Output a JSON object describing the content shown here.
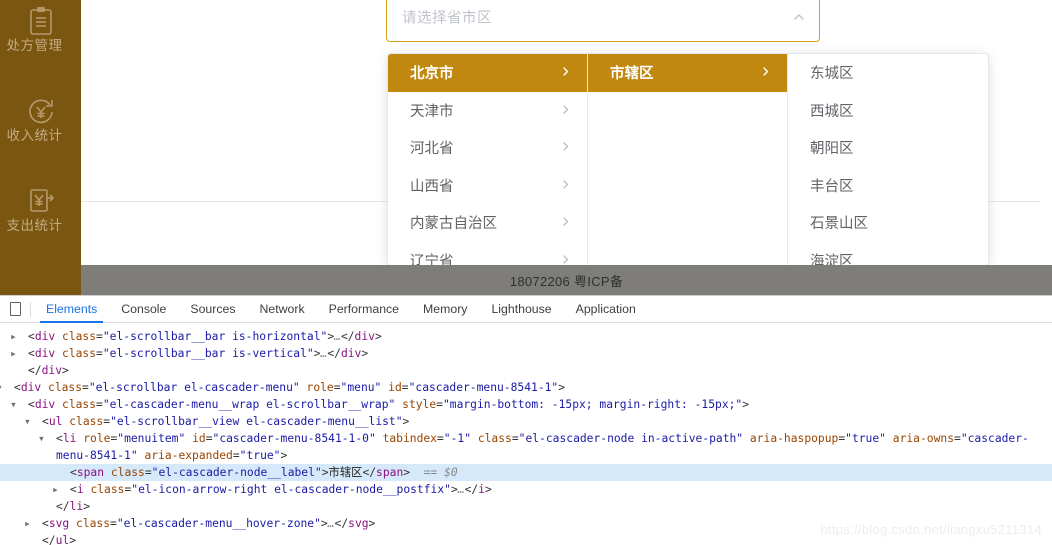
{
  "sidebar": {
    "items": [
      {
        "label": "处方管理",
        "icon": "clipboard-icon"
      },
      {
        "label": "收入统计",
        "icon": "income-yuan-circle-icon"
      },
      {
        "label": "支出统计",
        "icon": "expense-yuan-doc-icon"
      },
      {
        "label": "",
        "icon": "report-doc-icon"
      }
    ]
  },
  "cascader": {
    "placeholder": "请选择省市区",
    "value": "",
    "caret_icon": "chevron-up-icon",
    "columns": [
      {
        "name": "province-column",
        "nodes": [
          {
            "label": "北京市",
            "active": true,
            "has_children": true
          },
          {
            "label": "天津市",
            "active": false,
            "has_children": true
          },
          {
            "label": "河北省",
            "active": false,
            "has_children": true
          },
          {
            "label": "山西省",
            "active": false,
            "has_children": true
          },
          {
            "label": "内蒙古自治区",
            "active": false,
            "has_children": true
          },
          {
            "label": "辽宁省",
            "active": false,
            "has_children": true
          }
        ]
      },
      {
        "name": "city-column",
        "nodes": [
          {
            "label": "市辖区",
            "active": true,
            "has_children": true
          }
        ]
      },
      {
        "name": "district-column",
        "nodes": [
          {
            "label": "东城区",
            "active": false,
            "has_children": false
          },
          {
            "label": "西城区",
            "active": false,
            "has_children": false
          },
          {
            "label": "朝阳区",
            "active": false,
            "has_children": false
          },
          {
            "label": "丰台区",
            "active": false,
            "has_children": false
          },
          {
            "label": "石景山区",
            "active": false,
            "has_children": false
          },
          {
            "label": "海淀区",
            "active": false,
            "has_children": false
          }
        ]
      }
    ]
  },
  "footer": {
    "icp": "18072206 粤ICP备"
  },
  "devtools": {
    "device_toolbar_icon": "device-toolbar-icon",
    "tabs": [
      {
        "label": "Elements",
        "selected": true
      },
      {
        "label": "Console",
        "selected": false
      },
      {
        "label": "Sources",
        "selected": false
      },
      {
        "label": "Network",
        "selected": false
      },
      {
        "label": "Performance",
        "selected": false
      },
      {
        "label": "Memory",
        "selected": false
      },
      {
        "label": "Lighthouse",
        "selected": false
      },
      {
        "label": "Application",
        "selected": false
      }
    ],
    "dom_lines": [
      {
        "indent": 1,
        "twisty": "collapsed",
        "highlight": false,
        "parts": [
          {
            "t": "pun",
            "v": "<"
          },
          {
            "t": "tag",
            "v": "div"
          },
          {
            "t": "pun",
            "v": " "
          },
          {
            "t": "atn",
            "v": "class"
          },
          {
            "t": "pun",
            "v": "="
          },
          {
            "t": "atv",
            "v": "\"el-scrollbar__bar is-horizontal\""
          },
          {
            "t": "pun",
            "v": ">"
          },
          {
            "t": "cmt",
            "v": "…"
          },
          {
            "t": "pun",
            "v": "</"
          },
          {
            "t": "tag",
            "v": "div"
          },
          {
            "t": "pun",
            "v": ">"
          }
        ]
      },
      {
        "indent": 1,
        "twisty": "collapsed",
        "highlight": false,
        "parts": [
          {
            "t": "pun",
            "v": "<"
          },
          {
            "t": "tag",
            "v": "div"
          },
          {
            "t": "pun",
            "v": " "
          },
          {
            "t": "atn",
            "v": "class"
          },
          {
            "t": "pun",
            "v": "="
          },
          {
            "t": "atv",
            "v": "\"el-scrollbar__bar is-vertical\""
          },
          {
            "t": "pun",
            "v": ">"
          },
          {
            "t": "cmt",
            "v": "…"
          },
          {
            "t": "pun",
            "v": "</"
          },
          {
            "t": "tag",
            "v": "div"
          },
          {
            "t": "pun",
            "v": ">"
          }
        ]
      },
      {
        "indent": 1,
        "twisty": "none",
        "highlight": false,
        "parts": [
          {
            "t": "pun",
            "v": "</"
          },
          {
            "t": "tag",
            "v": "div"
          },
          {
            "t": "pun",
            "v": ">"
          }
        ]
      },
      {
        "indent": 0,
        "twisty": "expanded",
        "highlight": false,
        "parts": [
          {
            "t": "pun",
            "v": "<"
          },
          {
            "t": "tag",
            "v": "div"
          },
          {
            "t": "pun",
            "v": " "
          },
          {
            "t": "atn",
            "v": "class"
          },
          {
            "t": "pun",
            "v": "="
          },
          {
            "t": "atv",
            "v": "\"el-scrollbar el-cascader-menu\""
          },
          {
            "t": "pun",
            "v": " "
          },
          {
            "t": "atn",
            "v": "role"
          },
          {
            "t": "pun",
            "v": "="
          },
          {
            "t": "atv",
            "v": "\"menu\""
          },
          {
            "t": "pun",
            "v": " "
          },
          {
            "t": "atn",
            "v": "id"
          },
          {
            "t": "pun",
            "v": "="
          },
          {
            "t": "atv",
            "v": "\"cascader-menu-8541-1\""
          },
          {
            "t": "pun",
            "v": ">"
          }
        ]
      },
      {
        "indent": 1,
        "twisty": "expanded",
        "highlight": false,
        "parts": [
          {
            "t": "pun",
            "v": "<"
          },
          {
            "t": "tag",
            "v": "div"
          },
          {
            "t": "pun",
            "v": " "
          },
          {
            "t": "atn",
            "v": "class"
          },
          {
            "t": "pun",
            "v": "="
          },
          {
            "t": "atv",
            "v": "\"el-cascader-menu__wrap el-scrollbar__wrap\""
          },
          {
            "t": "pun",
            "v": " "
          },
          {
            "t": "atn",
            "v": "style"
          },
          {
            "t": "pun",
            "v": "="
          },
          {
            "t": "atv",
            "v": "\"margin-bottom: -15px; margin-right: -15px;\""
          },
          {
            "t": "pun",
            "v": ">"
          }
        ]
      },
      {
        "indent": 2,
        "twisty": "expanded",
        "highlight": false,
        "parts": [
          {
            "t": "pun",
            "v": "<"
          },
          {
            "t": "tag",
            "v": "ul"
          },
          {
            "t": "pun",
            "v": " "
          },
          {
            "t": "atn",
            "v": "class"
          },
          {
            "t": "pun",
            "v": "="
          },
          {
            "t": "atv",
            "v": "\"el-scrollbar__view el-cascader-menu__list\""
          },
          {
            "t": "pun",
            "v": ">"
          }
        ]
      },
      {
        "indent": 3,
        "twisty": "expanded",
        "highlight": false,
        "parts": [
          {
            "t": "pun",
            "v": "<"
          },
          {
            "t": "tag",
            "v": "li"
          },
          {
            "t": "pun",
            "v": " "
          },
          {
            "t": "atn",
            "v": "role"
          },
          {
            "t": "pun",
            "v": "="
          },
          {
            "t": "atv",
            "v": "\"menuitem\""
          },
          {
            "t": "pun",
            "v": " "
          },
          {
            "t": "atn",
            "v": "id"
          },
          {
            "t": "pun",
            "v": "="
          },
          {
            "t": "atv",
            "v": "\"cascader-menu-8541-1-0\""
          },
          {
            "t": "pun",
            "v": " "
          },
          {
            "t": "atn",
            "v": "tabindex"
          },
          {
            "t": "pun",
            "v": "="
          },
          {
            "t": "atv",
            "v": "\"-1\""
          },
          {
            "t": "pun",
            "v": " "
          },
          {
            "t": "atn",
            "v": "class"
          },
          {
            "t": "pun",
            "v": "="
          },
          {
            "t": "atv",
            "v": "\"el-cascader-node in-active-path\""
          },
          {
            "t": "pun",
            "v": " "
          },
          {
            "t": "atn",
            "v": "aria-haspopup"
          },
          {
            "t": "pun",
            "v": "="
          },
          {
            "t": "atv",
            "v": "\"true\""
          },
          {
            "t": "pun",
            "v": " "
          },
          {
            "t": "atn",
            "v": "aria-owns"
          },
          {
            "t": "pun",
            "v": "="
          },
          {
            "t": "atv",
            "v": "\"cascader-menu-8541-1\""
          },
          {
            "t": "pun",
            "v": " "
          },
          {
            "t": "atn",
            "v": "aria-expanded"
          },
          {
            "t": "pun",
            "v": "="
          },
          {
            "t": "atv",
            "v": "\"true\""
          },
          {
            "t": "pun",
            "v": ">"
          }
        ]
      },
      {
        "indent": 4,
        "twisty": "none",
        "highlight": true,
        "parts": [
          {
            "t": "pun",
            "v": "<"
          },
          {
            "t": "tag",
            "v": "span"
          },
          {
            "t": "pun",
            "v": " "
          },
          {
            "t": "atn",
            "v": "class"
          },
          {
            "t": "pun",
            "v": "="
          },
          {
            "t": "atv",
            "v": "\"el-cascader-node__label\""
          },
          {
            "t": "pun",
            "v": ">"
          },
          {
            "t": "txt",
            "v": "市辖区"
          },
          {
            "t": "pun",
            "v": "</"
          },
          {
            "t": "tag",
            "v": "span"
          },
          {
            "t": "pun",
            "v": ">"
          },
          {
            "t": "cmt",
            "v": "  == $0"
          }
        ]
      },
      {
        "indent": 4,
        "twisty": "collapsed",
        "highlight": false,
        "parts": [
          {
            "t": "pun",
            "v": "<"
          },
          {
            "t": "tag",
            "v": "i"
          },
          {
            "t": "pun",
            "v": " "
          },
          {
            "t": "atn",
            "v": "class"
          },
          {
            "t": "pun",
            "v": "="
          },
          {
            "t": "atv",
            "v": "\"el-icon-arrow-right el-cascader-node__postfix\""
          },
          {
            "t": "pun",
            "v": ">"
          },
          {
            "t": "cmt",
            "v": "…"
          },
          {
            "t": "pun",
            "v": "</"
          },
          {
            "t": "tag",
            "v": "i"
          },
          {
            "t": "pun",
            "v": ">"
          }
        ]
      },
      {
        "indent": 3,
        "twisty": "none",
        "highlight": false,
        "parts": [
          {
            "t": "pun",
            "v": "</"
          },
          {
            "t": "tag",
            "v": "li"
          },
          {
            "t": "pun",
            "v": ">"
          }
        ]
      },
      {
        "indent": 2,
        "twisty": "collapsed",
        "highlight": false,
        "parts": [
          {
            "t": "pun",
            "v": "<"
          },
          {
            "t": "tag",
            "v": "svg"
          },
          {
            "t": "pun",
            "v": " "
          },
          {
            "t": "atn",
            "v": "class"
          },
          {
            "t": "pun",
            "v": "="
          },
          {
            "t": "atv",
            "v": "\"el-cascader-menu__hover-zone\""
          },
          {
            "t": "pun",
            "v": ">"
          },
          {
            "t": "cmt",
            "v": "…"
          },
          {
            "t": "pun",
            "v": "</"
          },
          {
            "t": "tag",
            "v": "svg"
          },
          {
            "t": "pun",
            "v": ">"
          }
        ]
      },
      {
        "indent": 2,
        "twisty": "none",
        "highlight": false,
        "parts": [
          {
            "t": "pun",
            "v": "</"
          },
          {
            "t": "tag",
            "v": "ul"
          },
          {
            "t": "pun",
            "v": ">"
          }
        ]
      }
    ]
  },
  "watermark": {
    "text": "https://blog.csdn.net/liangxu5211314"
  }
}
